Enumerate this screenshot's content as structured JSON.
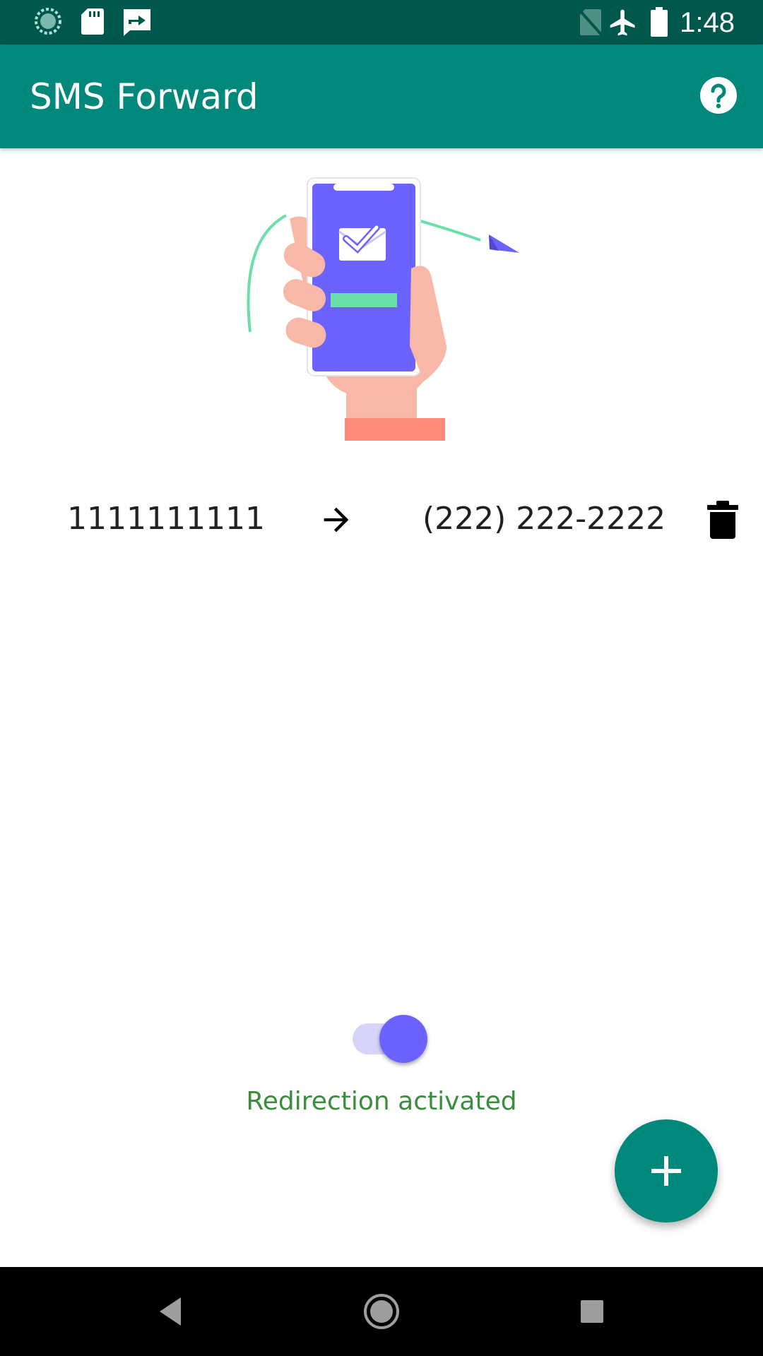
{
  "status_bar": {
    "time": "1:48",
    "left_icons": [
      "sync-progress-icon",
      "sd-card-icon",
      "forward-message-icon"
    ],
    "right_icons": [
      "no-sim-icon",
      "airplane-mode-icon",
      "battery-icon"
    ]
  },
  "app_bar": {
    "title": "SMS Forward",
    "help_icon": "help-circle-icon"
  },
  "rules": [
    {
      "from": "1111111111",
      "to": "(222) 222-2222"
    }
  ],
  "redirection": {
    "enabled": true,
    "status_text": "Redirection activated"
  },
  "fab": {
    "icon": "plus-icon"
  },
  "nav": {
    "buttons": [
      "back-icon",
      "home-icon",
      "recents-icon"
    ]
  },
  "colors": {
    "status_bar": "#00574b",
    "app_bar": "#00897b",
    "accent": "#6c63ff",
    "status_text": "#388e3c"
  }
}
